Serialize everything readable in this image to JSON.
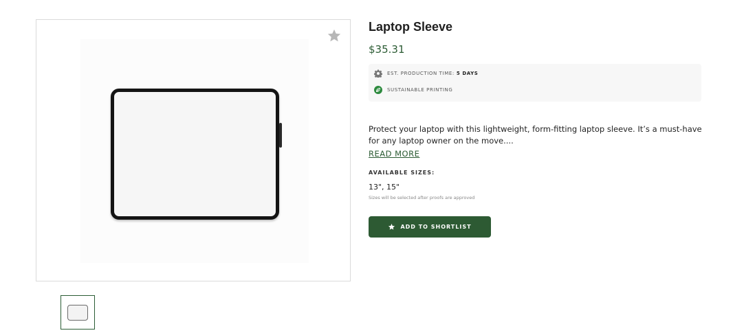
{
  "product": {
    "title": "Laptop Sleeve",
    "price": "$35.31",
    "description": "Protect your laptop with this lightweight, form-fitting laptop sleeve. It’s a must-have for any laptop owner on the move....",
    "read_more": "READ MORE"
  },
  "info": {
    "production_label": "EST. PRODUCTION TIME:",
    "production_value": "5 DAYS",
    "sustainable_label": "SUSTAINABLE PRINTING"
  },
  "sizes": {
    "label": "AVAILABLE SIZES:",
    "value": "13\", 15\"",
    "note": "Sizes will be selected after proofs are approved"
  },
  "actions": {
    "shortlist_label": "ADD TO SHORTLIST"
  },
  "icons": {
    "favorite": "star-icon",
    "production": "gear-icon",
    "sustainable": "leaf-icon",
    "button": "star-icon"
  },
  "colors": {
    "brand_green": "#2d5a33",
    "price_green": "#2b5b33",
    "info_background": "#f7f7f7",
    "favorite_star": "#b7b7b7"
  }
}
